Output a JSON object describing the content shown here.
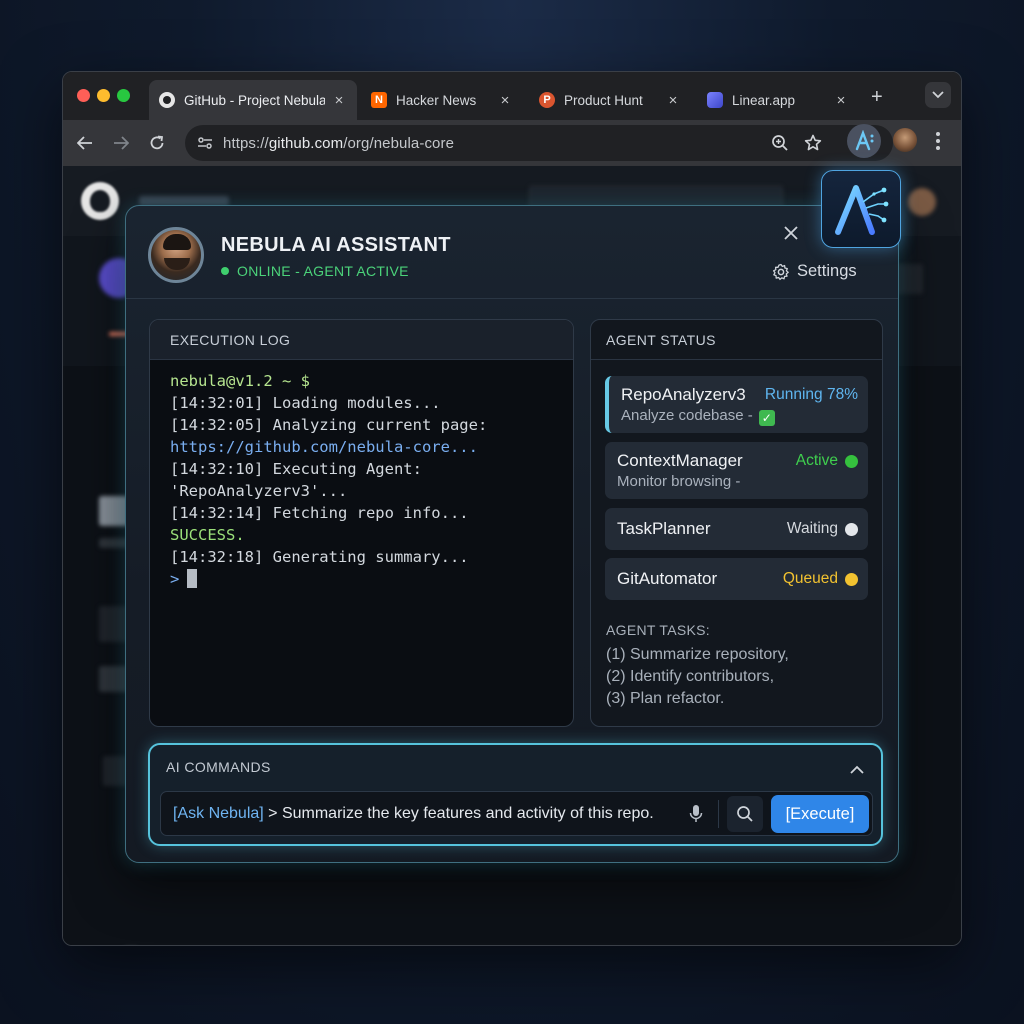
{
  "browser": {
    "tabs": [
      {
        "title": "GitHub - Project Nebula",
        "close": "×",
        "favicon": "github-icon"
      },
      {
        "title": "Hacker News",
        "close": "×",
        "favicon": "hacker-news-icon"
      },
      {
        "title": "Product Hunt",
        "close": "×",
        "favicon": "product-hunt-icon"
      },
      {
        "title": "Linear.app",
        "close": "×",
        "favicon": "linear-icon"
      }
    ],
    "new_tab": "+",
    "url_prefix": "https://",
    "url_host": "github.com",
    "url_path": "/org/nebula-core"
  },
  "assistant": {
    "title": "NEBULA AI ASSISTANT",
    "status": "ONLINE - AGENT ACTIVE",
    "settings_label": "Settings",
    "close": "×"
  },
  "execution_log": {
    "header": "EXECUTION LOG",
    "lines": [
      "nebula@v1.2 ~ $",
      "[14:32:01] Loading modules...",
      "[14:32:05] Analyzing current page:",
      "https://github.com/nebula-core...",
      "[14:32:10] Executing Agent:",
      "'RepoAnalyzerv3'...",
      "[14:32:14] Fetching repo info...",
      "SUCCESS.",
      "[14:32:18] Generating summary...",
      ">"
    ]
  },
  "agent_status": {
    "header": "AGENT STATUS",
    "agents": [
      {
        "name": "RepoAnalyzerv3",
        "state": "Running 78%",
        "detail": "Analyze codebase -",
        "state_color": "#5fb6f0"
      },
      {
        "name": "ContextManager",
        "state": "Active",
        "detail": "Monitor browsing -",
        "state_color": "#3fcf4e"
      },
      {
        "name": "TaskPlanner",
        "state": "Waiting",
        "detail": "",
        "state_color": "#d5d9de"
      },
      {
        "name": "GitAutomator",
        "state": "Queued",
        "detail": "",
        "state_color": "#f2c230"
      }
    ],
    "tasks_header": "AGENT TASKS:",
    "tasks": [
      "(1) Summarize repository,",
      "(2) Identify contributors,",
      "(3) Plan refactor."
    ]
  },
  "ai_commands": {
    "header": "AI COMMANDS",
    "input_tag": "[Ask Nebula]",
    "input_text": " > Summarize the key features and activity of this repo.",
    "execute_label": "[Execute]"
  },
  "colors": {
    "accent": "#56c3dc",
    "execute": "#2f86e8",
    "online": "#3fcf6e"
  }
}
